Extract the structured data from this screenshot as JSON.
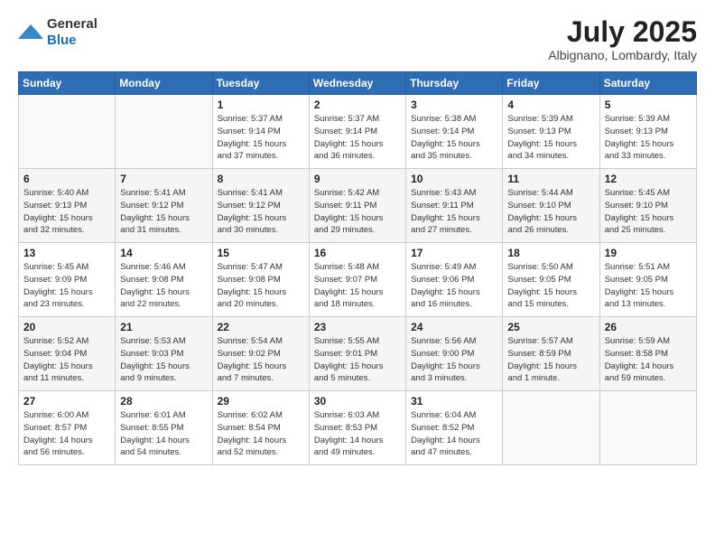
{
  "header": {
    "logo_general": "General",
    "logo_blue": "Blue",
    "month_year": "July 2025",
    "location": "Albignano, Lombardy, Italy"
  },
  "calendar": {
    "days_of_week": [
      "Sunday",
      "Monday",
      "Tuesday",
      "Wednesday",
      "Thursday",
      "Friday",
      "Saturday"
    ],
    "weeks": [
      [
        {
          "day": "",
          "detail": ""
        },
        {
          "day": "",
          "detail": ""
        },
        {
          "day": "1",
          "detail": "Sunrise: 5:37 AM\nSunset: 9:14 PM\nDaylight: 15 hours\nand 37 minutes."
        },
        {
          "day": "2",
          "detail": "Sunrise: 5:37 AM\nSunset: 9:14 PM\nDaylight: 15 hours\nand 36 minutes."
        },
        {
          "day": "3",
          "detail": "Sunrise: 5:38 AM\nSunset: 9:14 PM\nDaylight: 15 hours\nand 35 minutes."
        },
        {
          "day": "4",
          "detail": "Sunrise: 5:39 AM\nSunset: 9:13 PM\nDaylight: 15 hours\nand 34 minutes."
        },
        {
          "day": "5",
          "detail": "Sunrise: 5:39 AM\nSunset: 9:13 PM\nDaylight: 15 hours\nand 33 minutes."
        }
      ],
      [
        {
          "day": "6",
          "detail": "Sunrise: 5:40 AM\nSunset: 9:13 PM\nDaylight: 15 hours\nand 32 minutes."
        },
        {
          "day": "7",
          "detail": "Sunrise: 5:41 AM\nSunset: 9:12 PM\nDaylight: 15 hours\nand 31 minutes."
        },
        {
          "day": "8",
          "detail": "Sunrise: 5:41 AM\nSunset: 9:12 PM\nDaylight: 15 hours\nand 30 minutes."
        },
        {
          "day": "9",
          "detail": "Sunrise: 5:42 AM\nSunset: 9:11 PM\nDaylight: 15 hours\nand 29 minutes."
        },
        {
          "day": "10",
          "detail": "Sunrise: 5:43 AM\nSunset: 9:11 PM\nDaylight: 15 hours\nand 27 minutes."
        },
        {
          "day": "11",
          "detail": "Sunrise: 5:44 AM\nSunset: 9:10 PM\nDaylight: 15 hours\nand 26 minutes."
        },
        {
          "day": "12",
          "detail": "Sunrise: 5:45 AM\nSunset: 9:10 PM\nDaylight: 15 hours\nand 25 minutes."
        }
      ],
      [
        {
          "day": "13",
          "detail": "Sunrise: 5:45 AM\nSunset: 9:09 PM\nDaylight: 15 hours\nand 23 minutes."
        },
        {
          "day": "14",
          "detail": "Sunrise: 5:46 AM\nSunset: 9:08 PM\nDaylight: 15 hours\nand 22 minutes."
        },
        {
          "day": "15",
          "detail": "Sunrise: 5:47 AM\nSunset: 9:08 PM\nDaylight: 15 hours\nand 20 minutes."
        },
        {
          "day": "16",
          "detail": "Sunrise: 5:48 AM\nSunset: 9:07 PM\nDaylight: 15 hours\nand 18 minutes."
        },
        {
          "day": "17",
          "detail": "Sunrise: 5:49 AM\nSunset: 9:06 PM\nDaylight: 15 hours\nand 16 minutes."
        },
        {
          "day": "18",
          "detail": "Sunrise: 5:50 AM\nSunset: 9:05 PM\nDaylight: 15 hours\nand 15 minutes."
        },
        {
          "day": "19",
          "detail": "Sunrise: 5:51 AM\nSunset: 9:05 PM\nDaylight: 15 hours\nand 13 minutes."
        }
      ],
      [
        {
          "day": "20",
          "detail": "Sunrise: 5:52 AM\nSunset: 9:04 PM\nDaylight: 15 hours\nand 11 minutes."
        },
        {
          "day": "21",
          "detail": "Sunrise: 5:53 AM\nSunset: 9:03 PM\nDaylight: 15 hours\nand 9 minutes."
        },
        {
          "day": "22",
          "detail": "Sunrise: 5:54 AM\nSunset: 9:02 PM\nDaylight: 15 hours\nand 7 minutes."
        },
        {
          "day": "23",
          "detail": "Sunrise: 5:55 AM\nSunset: 9:01 PM\nDaylight: 15 hours\nand 5 minutes."
        },
        {
          "day": "24",
          "detail": "Sunrise: 5:56 AM\nSunset: 9:00 PM\nDaylight: 15 hours\nand 3 minutes."
        },
        {
          "day": "25",
          "detail": "Sunrise: 5:57 AM\nSunset: 8:59 PM\nDaylight: 15 hours\nand 1 minute."
        },
        {
          "day": "26",
          "detail": "Sunrise: 5:59 AM\nSunset: 8:58 PM\nDaylight: 14 hours\nand 59 minutes."
        }
      ],
      [
        {
          "day": "27",
          "detail": "Sunrise: 6:00 AM\nSunset: 8:57 PM\nDaylight: 14 hours\nand 56 minutes."
        },
        {
          "day": "28",
          "detail": "Sunrise: 6:01 AM\nSunset: 8:55 PM\nDaylight: 14 hours\nand 54 minutes."
        },
        {
          "day": "29",
          "detail": "Sunrise: 6:02 AM\nSunset: 8:54 PM\nDaylight: 14 hours\nand 52 minutes."
        },
        {
          "day": "30",
          "detail": "Sunrise: 6:03 AM\nSunset: 8:53 PM\nDaylight: 14 hours\nand 49 minutes."
        },
        {
          "day": "31",
          "detail": "Sunrise: 6:04 AM\nSunset: 8:52 PM\nDaylight: 14 hours\nand 47 minutes."
        },
        {
          "day": "",
          "detail": ""
        },
        {
          "day": "",
          "detail": ""
        }
      ]
    ]
  }
}
